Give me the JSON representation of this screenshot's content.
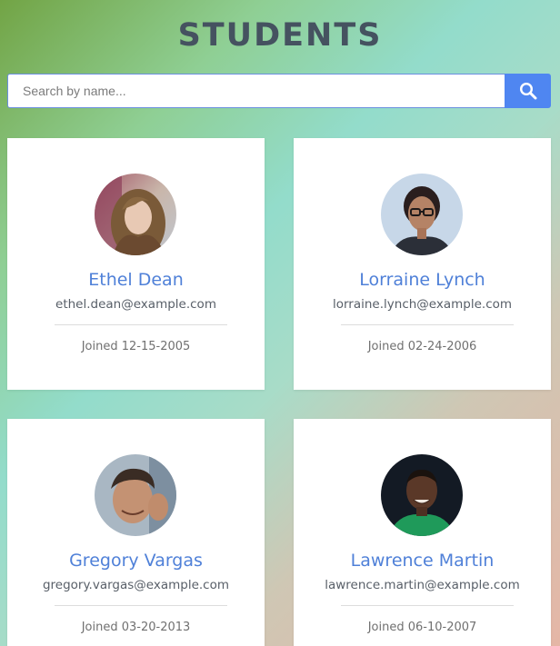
{
  "header": {
    "title": "STUDENTS"
  },
  "search": {
    "placeholder": "Search by name...",
    "value": "",
    "button_icon": "search-icon"
  },
  "students": [
    {
      "name": "Ethel Dean",
      "email": "ethel.dean@example.com",
      "joined": "Joined 12-15-2005",
      "avatar_icon": "avatar-photo"
    },
    {
      "name": "Lorraine Lynch",
      "email": "lorraine.lynch@example.com",
      "joined": "Joined 02-24-2006",
      "avatar_icon": "avatar-photo"
    },
    {
      "name": "Gregory Vargas",
      "email": "gregory.vargas@example.com",
      "joined": "Joined 03-20-2013",
      "avatar_icon": "avatar-photo"
    },
    {
      "name": "Lawrence Martin",
      "email": "lawrence.martin@example.com",
      "joined": "Joined 06-10-2007",
      "avatar_icon": "avatar-photo"
    }
  ],
  "colors": {
    "accent": "#4f86f1",
    "name_text": "#4f80d8",
    "title_text": "#455260"
  }
}
